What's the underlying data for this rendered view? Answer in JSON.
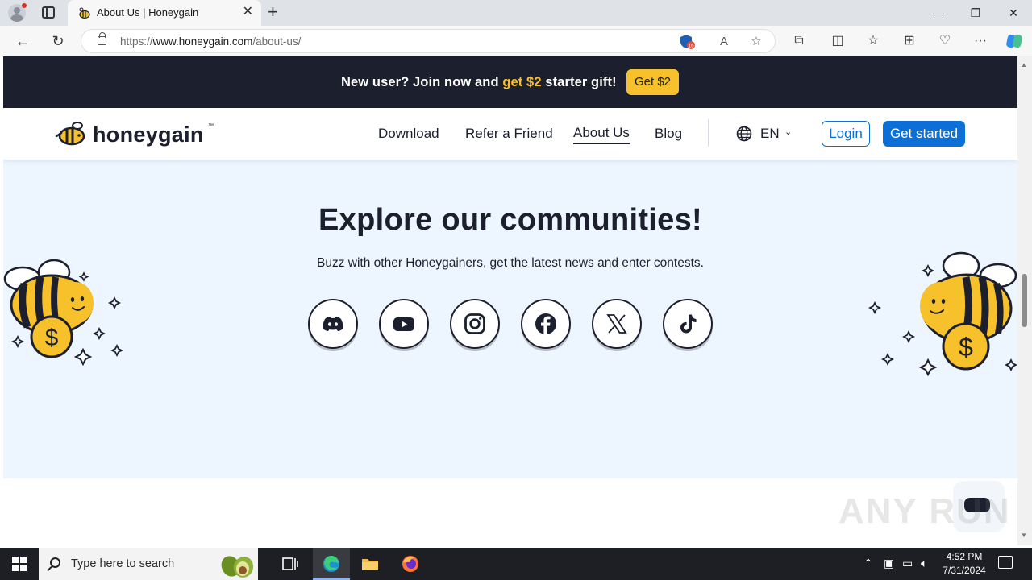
{
  "browser": {
    "tab_title": "About Us | Honeygain",
    "tab_close": "✕",
    "new_tab": "+",
    "url_prefix": "https://",
    "url_host": "www.honeygain.com",
    "url_path": "/about-us/",
    "shield_badge": "16",
    "window_controls": {
      "minimize": "—",
      "restore": "❐",
      "close": "✕"
    }
  },
  "promo": {
    "text_before": "New user? Join now and ",
    "text_highlight": "get $2",
    "text_after": " starter gift!",
    "button": "Get $2",
    "highlight_color": "#f6c12b"
  },
  "header": {
    "logo": "honeygain",
    "logo_tm": "™",
    "nav": [
      {
        "label": "Download"
      },
      {
        "label": "Refer a Friend"
      },
      {
        "label": "About Us",
        "active": true
      },
      {
        "label": "Blog"
      }
    ],
    "language": "EN",
    "login": "Login",
    "get_started": "Get started",
    "accent_color": "#0b6fd6"
  },
  "community": {
    "title": "Explore our communities!",
    "subtitle": "Buzz with other Honeygainers, get the latest news and enter contests.",
    "socials": [
      {
        "icon": "discord-icon"
      },
      {
        "icon": "youtube-icon"
      },
      {
        "icon": "instagram-icon"
      },
      {
        "icon": "facebook-icon"
      },
      {
        "icon": "x-icon"
      },
      {
        "icon": "tiktok-icon"
      }
    ],
    "background_color": "#edf5ff"
  },
  "watermark": "ANY RUN",
  "taskbar": {
    "search_placeholder": "Type here to search",
    "time": "4:52 PM",
    "date": "7/31/2024"
  }
}
